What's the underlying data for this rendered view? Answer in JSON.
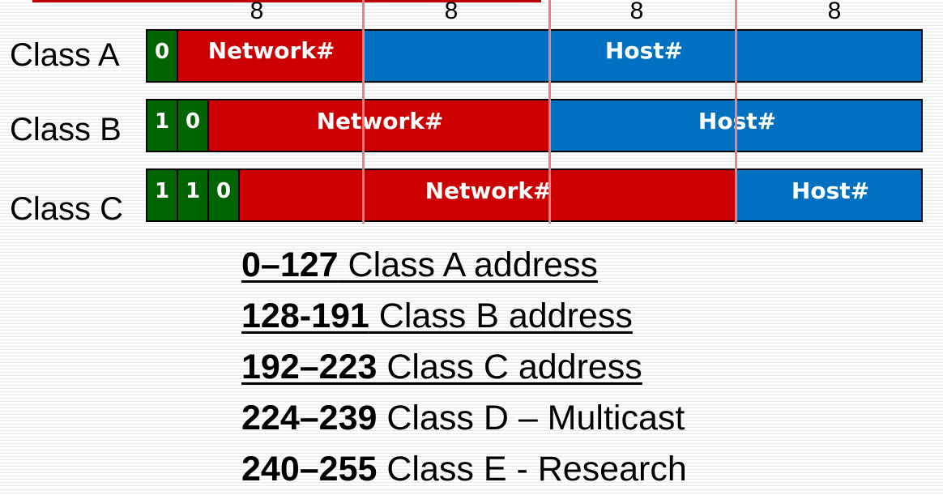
{
  "octet_labels": [
    "8",
    "8",
    "8",
    "8"
  ],
  "classes": [
    {
      "label": "Class A",
      "bits": [
        "0"
      ],
      "network_label": "Network#",
      "host_label": "Host#"
    },
    {
      "label": "Class B",
      "bits": [
        "1",
        "0"
      ],
      "network_label": "Network#",
      "host_label": "Host#"
    },
    {
      "label": "Class C",
      "bits": [
        "1",
        "1",
        "0"
      ],
      "network_label": "Network#",
      "host_label": "Host#"
    }
  ],
  "ranges": [
    {
      "range": "0–127",
      "desc": " Class A address",
      "underlined": true
    },
    {
      "range": "128-191",
      "desc": " Class B address",
      "underlined": true
    },
    {
      "range": "192–223",
      "desc": " Class C address",
      "underlined": true
    },
    {
      "range": "224–239",
      "desc": " Class D – Multicast",
      "underlined": false
    },
    {
      "range": "240–255",
      "desc": " Class E - Research",
      "underlined": false
    }
  ],
  "colors": {
    "network": "#cc0000",
    "host": "#0070c0",
    "class_bits": "#006400",
    "byte_boundary": "#f08080"
  }
}
